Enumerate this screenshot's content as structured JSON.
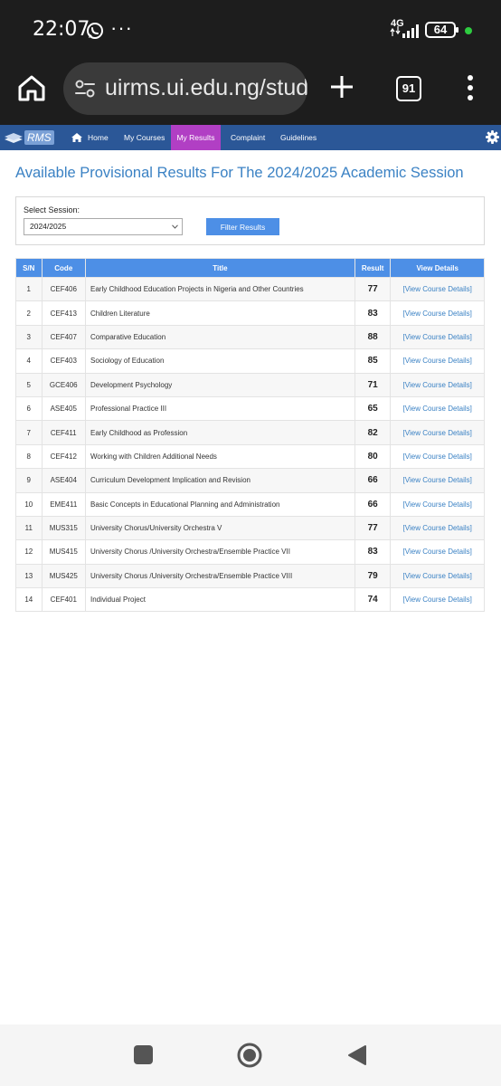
{
  "status_bar": {
    "time": "22:07",
    "dots": "···",
    "network": "4G",
    "battery": "64",
    "icons": [
      "whatsapp-icon",
      "signal-icon",
      "battery-icon"
    ]
  },
  "browser": {
    "url": "uirms.ui.edu.ng/stude",
    "tab_count": "91",
    "icons": [
      "home-icon",
      "tune-icon",
      "plus-icon",
      "more-vertical-icon"
    ]
  },
  "nav": {
    "brand": "RMS",
    "items": [
      "Home",
      "My Courses",
      "My Results",
      "Complaint",
      "Guidelines"
    ],
    "active_color": "#b13fc4",
    "bar_color": "#2b5797"
  },
  "page": {
    "title": "Available Provisional Results For The 2024/2025 Academic Session"
  },
  "filter": {
    "label": "Select Session:",
    "selected": "2024/2025",
    "button": "Filter Results"
  },
  "table": {
    "headers": [
      "S/N",
      "Code",
      "Title",
      "Result",
      "View Details"
    ],
    "rows": [
      {
        "sn": "1",
        "code": "CEF406",
        "title": "Early Childhood Education Projects in Nigeria and Other Countries",
        "result": "77",
        "link": "[View Course Details]"
      },
      {
        "sn": "2",
        "code": "CEF413",
        "title": "Children Literature",
        "result": "83",
        "link": "[View Course Details]"
      },
      {
        "sn": "3",
        "code": "CEF407",
        "title": "Comparative Education",
        "result": "88",
        "link": "[View Course Details]"
      },
      {
        "sn": "4",
        "code": "CEF403",
        "title": "Sociology of Education",
        "result": "85",
        "link": "[View Course Details]"
      },
      {
        "sn": "5",
        "code": "GCE406",
        "title": "Development Psychology",
        "result": "71",
        "link": "[View Course Details]"
      },
      {
        "sn": "6",
        "code": "ASE405",
        "title": "Professional Practice III",
        "result": "65",
        "link": "[View Course Details]"
      },
      {
        "sn": "7",
        "code": "CEF411",
        "title": "Early Childhood as Profession",
        "result": "82",
        "link": "[View Course Details]"
      },
      {
        "sn": "8",
        "code": "CEF412",
        "title": "Working with Children Additional Needs",
        "result": "80",
        "link": "[View Course Details]"
      },
      {
        "sn": "9",
        "code": "ASE404",
        "title": "Curriculum Development Implication and Revision",
        "result": "66",
        "link": "[View Course Details]"
      },
      {
        "sn": "10",
        "code": "EME411",
        "title": "Basic Concepts in Educational Planning and Administration",
        "result": "66",
        "link": "[View Course Details]"
      },
      {
        "sn": "11",
        "code": "MUS315",
        "title": "University Chorus/University Orchestra V",
        "result": "77",
        "link": "[View Course Details]"
      },
      {
        "sn": "12",
        "code": "MUS415",
        "title": "University Chorus /University Orchestra/Ensemble Practice VII",
        "result": "83",
        "link": "[View Course Details]"
      },
      {
        "sn": "13",
        "code": "MUS425",
        "title": "University Chorus /University Orchestra/Ensemble Practice VIII",
        "result": "79",
        "link": "[View Course Details]"
      },
      {
        "sn": "14",
        "code": "CEF401",
        "title": "Individual Project",
        "result": "74",
        "link": "[View Course Details]"
      }
    ]
  },
  "bottom_nav": {
    "icons": [
      "recents-icon",
      "home-circle-icon",
      "back-icon"
    ]
  }
}
